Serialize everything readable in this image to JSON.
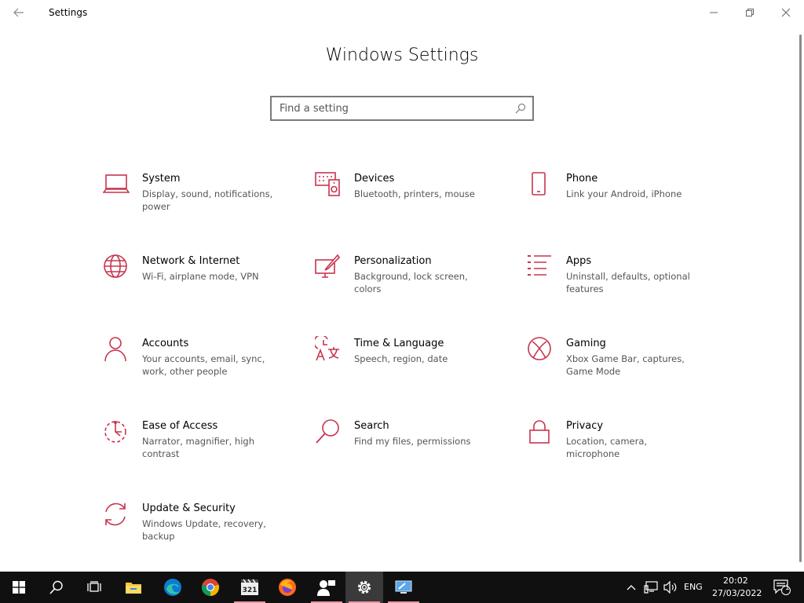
{
  "window": {
    "title": "Settings"
  },
  "page": {
    "title": "Windows Settings"
  },
  "search": {
    "placeholder": "Find a setting"
  },
  "accent": "#c8344e",
  "tiles": [
    {
      "name": "System",
      "desc": "Display, sound, notifications, power",
      "icon": "laptop-icon"
    },
    {
      "name": "Devices",
      "desc": "Bluetooth, printers, mouse",
      "icon": "devices-icon"
    },
    {
      "name": "Phone",
      "desc": "Link your Android, iPhone",
      "icon": "phone-icon"
    },
    {
      "name": "Network & Internet",
      "desc": "Wi-Fi, airplane mode, VPN",
      "icon": "globe-icon"
    },
    {
      "name": "Personalization",
      "desc": "Background, lock screen, colors",
      "icon": "paintbrush-icon"
    },
    {
      "name": "Apps",
      "desc": "Uninstall, defaults, optional features",
      "icon": "apps-list-icon"
    },
    {
      "name": "Accounts",
      "desc": "Your accounts, email, sync, work, other people",
      "icon": "person-icon"
    },
    {
      "name": "Time & Language",
      "desc": "Speech, region, date",
      "icon": "time-language-icon"
    },
    {
      "name": "Gaming",
      "desc": "Xbox Game Bar, captures, Game Mode",
      "icon": "xbox-icon"
    },
    {
      "name": "Ease of Access",
      "desc": "Narrator, magnifier, high contrast",
      "icon": "ease-of-access-icon"
    },
    {
      "name": "Search",
      "desc": "Find my files, permissions",
      "icon": "magnifier-icon"
    },
    {
      "name": "Privacy",
      "desc": "Location, camera, microphone",
      "icon": "lock-icon"
    },
    {
      "name": "Update & Security",
      "desc": "Windows Update, recovery, backup",
      "icon": "update-icon"
    }
  ],
  "taskbar": {
    "apps": [
      "start-icon",
      "search-icon",
      "task-view-icon",
      "file-explorer-icon",
      "edge-icon",
      "chrome-icon",
      "media-player-icon",
      "firefox-icon",
      "user-app-icon",
      "settings-gear-icon",
      "rdp-icon"
    ],
    "language": "ENG",
    "time": "20:02",
    "date": "27/03/2022",
    "notification_count": "1"
  }
}
